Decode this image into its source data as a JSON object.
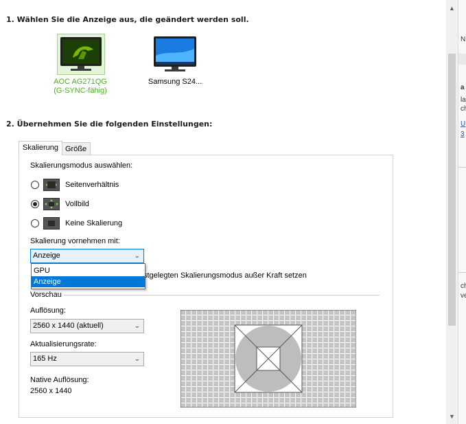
{
  "section1": {
    "heading": "1. Wählen Sie die Anzeige aus, die geändert werden soll."
  },
  "monitors": [
    {
      "name_line1": "AOC AG271QG",
      "name_line2": "(G-SYNC-fähig)",
      "selected": true,
      "icon": "nvidia-monitor-icon"
    },
    {
      "name_line1": "Samsung S24...",
      "name_line2": "",
      "selected": false,
      "icon": "windows-monitor-icon"
    }
  ],
  "section2": {
    "heading": "2. Übernehmen Sie die folgenden Einstellungen:"
  },
  "tabs": [
    {
      "label": "Skalierung",
      "active": true
    },
    {
      "label": "Größe",
      "active": false
    }
  ],
  "scaling": {
    "mode_label": "Skalierungsmodus auswählen:",
    "options": [
      {
        "label": "Seitenverhältnis",
        "checked": false,
        "icon": "aspect-ratio-icon"
      },
      {
        "label": "Vollbild",
        "checked": true,
        "icon": "fullscreen-icon"
      },
      {
        "label": "Keine Skalierung",
        "checked": false,
        "icon": "no-scaling-icon"
      }
    ],
    "perform_label": "Skalierung vornehmen mit:",
    "perform_value": "Anzeige",
    "dropdown_options": [
      {
        "label": "GPU",
        "selected": false
      },
      {
        "label": "Anzeige",
        "selected": true
      }
    ],
    "override_text": "stgelegten Skalierungsmodus außer Kraft setzen"
  },
  "preview": {
    "label": "Vorschau",
    "resolution_label": "Auflösung:",
    "resolution_value": "2560 x 1440 (aktuell)",
    "refresh_label": "Aktualisierungsrate:",
    "refresh_value": "165 Hz",
    "native_label": "Native Auflösung:",
    "native_value": "2560 x 1440"
  },
  "right_pane": {
    "snippets": [
      "N",
      "a",
      "la",
      "ch",
      "U",
      "3",
      "ch",
      "ve"
    ]
  },
  "colors": {
    "nvidia_green": "#76b900",
    "selected_label": "#4caf1a",
    "accent": "#0078d7"
  }
}
